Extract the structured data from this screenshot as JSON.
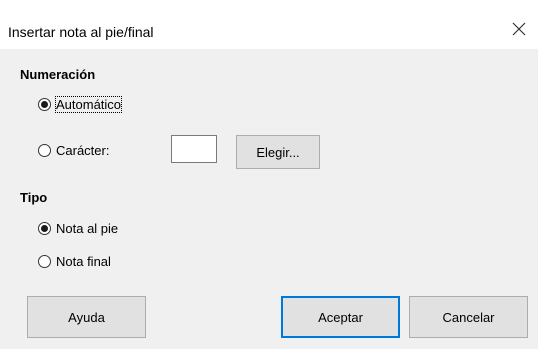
{
  "dialog": {
    "title": "Insertar nota al pie/final",
    "close_symbol": "×"
  },
  "numbering": {
    "heading": "Numeración",
    "automatic_label": "Automático",
    "character_label": "Carácter:",
    "character_value": "",
    "choose_button": "Elegir..."
  },
  "type": {
    "heading": "Tipo",
    "footnote_label": "Nota al pie",
    "endnote_label": "Nota final"
  },
  "buttons": {
    "help": "Ayuda",
    "ok": "Aceptar",
    "cancel": "Cancelar"
  },
  "colors": {
    "default_button_border": "#0078d7",
    "dialog_background": "#f0f0f0"
  },
  "icons": {
    "close": "close-icon"
  }
}
